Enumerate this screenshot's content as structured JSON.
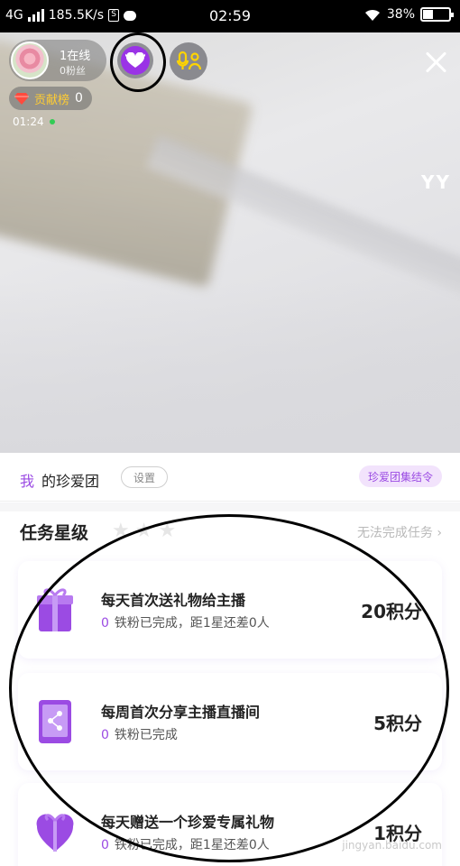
{
  "status_bar": {
    "network": "4G",
    "speed": "185.5K/s",
    "time": "02:59",
    "battery": "38%",
    "icons": [
      "signal-icon",
      "sim-icon",
      "chat-bubble-icon",
      "wifi-icon",
      "battery-icon"
    ]
  },
  "live": {
    "online": "1在线",
    "fans": "0粉丝",
    "rank_label": "贡献榜",
    "rank_value": "0",
    "timer": "01:24",
    "watermark": "YY",
    "icons": [
      "host-avatar",
      "fan-club-heart-icon",
      "mic-guests-icon",
      "close-icon",
      "diamond-icon"
    ]
  },
  "panel": {
    "me": "我",
    "title": "的珍爱团",
    "settings": "设置",
    "rally": "珍爱团集结令",
    "task_level_title": "任务星级",
    "cannot_complete": "无法完成任务",
    "tasks": [
      {
        "name": "每天首次送礼物给主播",
        "count": "0",
        "status": "铁粉已完成，距1星还差0人",
        "points": "20积分",
        "icon": "gift-icon"
      },
      {
        "name": "每周首次分享主播直播间",
        "count": "0",
        "status": "铁粉已完成",
        "points": "5积分",
        "icon": "share-phone-icon"
      },
      {
        "name": "每天赠送一个珍爱专属礼物",
        "count": "0",
        "status": "铁粉已完成，距1星还差0人",
        "points": "1积分",
        "icon": "heart-gift-icon"
      }
    ],
    "page_watermark": "jingyan.baidu.com"
  },
  "colors": {
    "accent": "#9b4be3",
    "rank_label": "#ffcc33",
    "online_dot": "#33cc55"
  }
}
